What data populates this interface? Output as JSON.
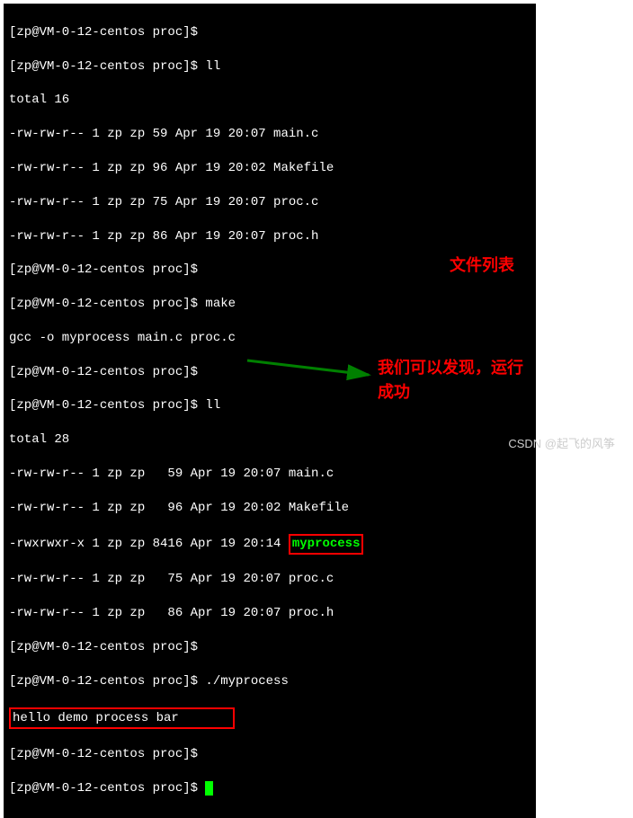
{
  "prompt_text": "[zp@VM-0-12-centos proc]$",
  "lines": {
    "l0": "[zp@VM-0-12-centos proc]$ ",
    "l1": "[zp@VM-0-12-centos proc]$ ll",
    "l2": "total 16",
    "l3": "-rw-rw-r-- 1 zp zp 59 Apr 19 20:07 main.c",
    "l4": "-rw-rw-r-- 1 zp zp 96 Apr 19 20:02 Makefile",
    "l5": "-rw-rw-r-- 1 zp zp 75 Apr 19 20:07 proc.c",
    "l6": "-rw-rw-r-- 1 zp zp 86 Apr 19 20:07 proc.h",
    "l7": "[zp@VM-0-12-centos proc]$ ",
    "l8": "[zp@VM-0-12-centos proc]$ make",
    "l9": "gcc -o myprocess main.c proc.c",
    "l10": "[zp@VM-0-12-centos proc]$ ",
    "l11": "[zp@VM-0-12-centos proc]$ ll",
    "l12": "total 28",
    "l13": "-rw-rw-r-- 1 zp zp   59 Apr 19 20:07 main.c",
    "l14": "-rw-rw-r-- 1 zp zp   96 Apr 19 20:02 Makefile",
    "l15a": "-rwxrwxr-x 1 zp zp 8416 Apr 19 20:14 ",
    "l15b": "myprocess",
    "l16": "-rw-rw-r-- 1 zp zp   75 Apr 19 20:07 proc.c",
    "l17": "-rw-rw-r-- 1 zp zp   86 Apr 19 20:07 proc.h",
    "l18": "[zp@VM-0-12-centos proc]$ ",
    "l19": "[zp@VM-0-12-centos proc]$ ./myprocess",
    "l20": "hello demo process bar",
    "l21": "[zp@VM-0-12-centos proc]$ ",
    "l22": "[zp@VM-0-12-centos proc]$ "
  },
  "annotations": {
    "file_list": "文件列表",
    "success_l1": "我们可以发现，运行",
    "success_l2": "成功"
  },
  "watermark": "CSDN @起飞的风筝",
  "colors": {
    "exec_green": "#00ff00",
    "highlight_red": "#ff0000",
    "arrow_green": "#008000"
  }
}
